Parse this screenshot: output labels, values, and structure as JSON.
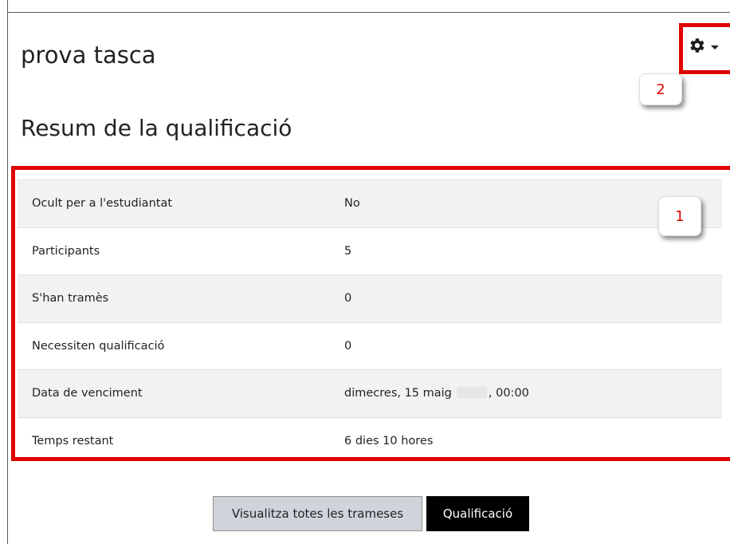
{
  "header": {
    "title": "prova tasca",
    "settings_icon": "gear-icon"
  },
  "section": {
    "title": "Resum de la qualificació"
  },
  "summary": {
    "rows": [
      {
        "label": "Ocult per a l'estudiantat",
        "value": "No"
      },
      {
        "label": "Participants",
        "value": "5"
      },
      {
        "label": "S'han tramès",
        "value": "0"
      },
      {
        "label": "Necessiten qualificació",
        "value": "0"
      },
      {
        "label": "Data de venciment",
        "value_prefix": "dimecres, 15 maig",
        "value_suffix": ", 00:00"
      },
      {
        "label": "Temps restant",
        "value": "6 dies 10 hores"
      }
    ]
  },
  "callouts": {
    "one": "1",
    "two": "2"
  },
  "actions": {
    "view_all": "Visualitza totes les trameses",
    "grade": "Qualificació"
  },
  "colors": {
    "highlight": "#e00000",
    "primary_button": "#000000",
    "secondary_button": "#ced4da"
  }
}
